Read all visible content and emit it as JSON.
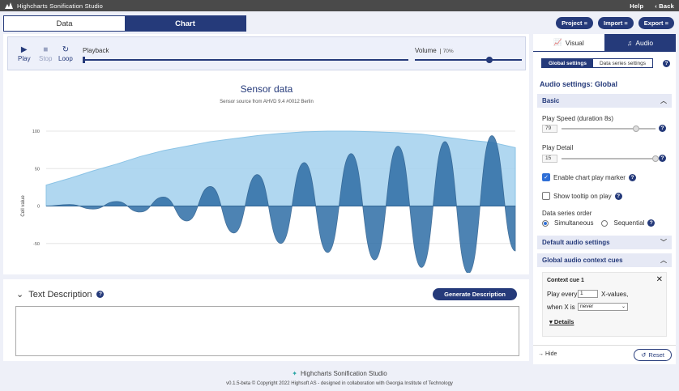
{
  "app": {
    "title": "Highcharts Sonification Studio",
    "help": "Help",
    "back": "Back"
  },
  "tabs": {
    "data": "Data",
    "chart": "Chart"
  },
  "header_buttons": {
    "project": "Project ≡",
    "import": "Import ≡",
    "export": "Export ≡"
  },
  "player": {
    "play": "Play",
    "stop": "Stop",
    "loop": "Loop",
    "playback": "Playback",
    "volume": "Volume",
    "volume_value": "70%",
    "volume_level": 0.7
  },
  "chart_data": {
    "type": "area",
    "title": "Sensor data",
    "subtitle": "Sensor source from AHVD 9.4 #0012 Berlin",
    "ylabel": "Cell value",
    "xlabel": "",
    "y_ticks": [
      "100",
      "50",
      "0",
      "-50",
      "-100"
    ],
    "x_ticks": [
      "10",
      "20",
      "30",
      "40",
      "50",
      "60",
      "70",
      "80",
      "90",
      "100"
    ],
    "ylim": [
      -100,
      100
    ],
    "grid": true,
    "series": [
      {
        "x": [
          10,
          15,
          20,
          25,
          30,
          35,
          40,
          45,
          50,
          55,
          60,
          65,
          70,
          75,
          80,
          85,
          90,
          95,
          100,
          105,
          110
        ],
        "values": [
          28,
          37,
          47,
          56,
          66,
          74,
          80,
          86,
          90,
          94,
          97,
          99,
          100,
          100,
          99,
          98,
          96,
          92,
          88,
          85,
          78
        ]
      },
      {
        "x": [
          10,
          15,
          20,
          25,
          30,
          35,
          40,
          45,
          50,
          55,
          60,
          65,
          70,
          75,
          80,
          85,
          90,
          95,
          100,
          105,
          110
        ],
        "values": [
          0,
          2,
          -4,
          6,
          -8,
          12,
          -20,
          26,
          -36,
          42,
          -50,
          58,
          -62,
          70,
          -72,
          80,
          -82,
          86,
          -90,
          94,
          -60
        ]
      }
    ],
    "colors": {
      "upper": "#a8d3ef",
      "lower": "#2f6ea6"
    }
  },
  "description": {
    "title": "Text Description",
    "button": "Generate Description",
    "text": ""
  },
  "side": {
    "tab_visual": "Visual",
    "tab_audio": "Audio",
    "seg_global": "Global settings",
    "seg_series": "Data series settings",
    "heading": "Audio settings: Global",
    "basic": "Basic",
    "play_speed_label": "Play Speed (duration 8s)",
    "play_speed": "79",
    "play_speed_level": 0.79,
    "play_detail_label": "Play Detail",
    "play_detail": "15",
    "play_detail_level": 1.0,
    "enable_marker": "Enable chart play marker",
    "show_tooltip": "Show tooltip on play",
    "order_label": "Data series order",
    "simultaneous": "Simultaneous",
    "sequential": "Sequential",
    "default_audio": "Default audio settings",
    "context_cues": "Global audio context cues",
    "cue_title": "Context cue 1",
    "play_every": "Play every",
    "play_every_val": "1",
    "x_values": "X-values,",
    "when_x": "when X is",
    "when_x_val": "never",
    "details": "Details",
    "hide": "Hide",
    "reset": "Reset"
  },
  "footer": {
    "brand": "Highcharts Sonification Studio",
    "copyright": "v0.1.5-beta  © Copyright 2022 Highsoft AS - designed in collaboration with Georgia Institute of Technology"
  }
}
